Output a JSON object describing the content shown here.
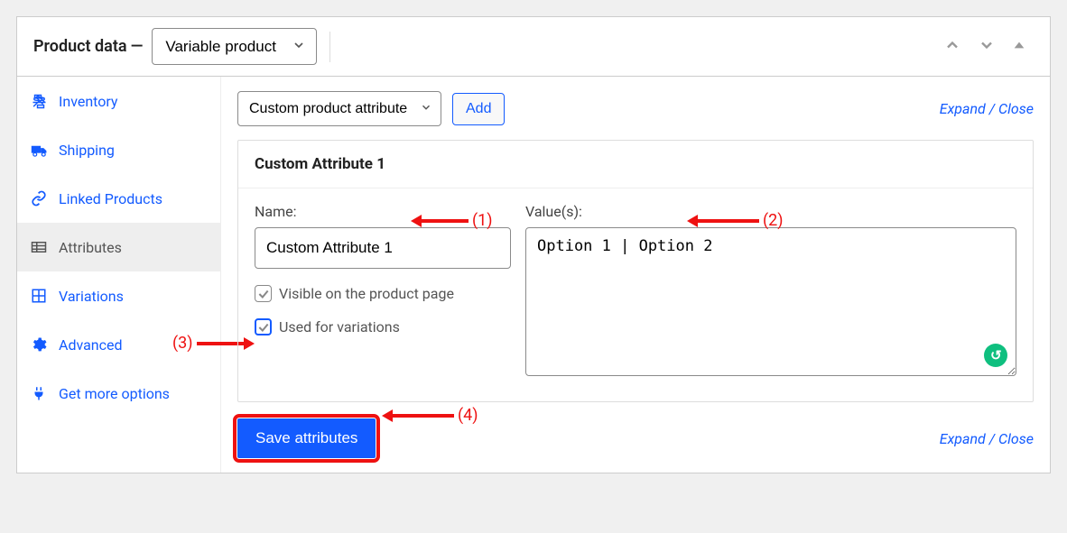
{
  "header": {
    "title": "Product data",
    "product_type": "Variable product"
  },
  "sidebar": {
    "items": [
      {
        "label": "Inventory"
      },
      {
        "label": "Shipping"
      },
      {
        "label": "Linked Products"
      },
      {
        "label": "Attributes"
      },
      {
        "label": "Variations"
      },
      {
        "label": "Advanced"
      },
      {
        "label": "Get more options"
      }
    ]
  },
  "main": {
    "attr_select": "Custom product attribute",
    "add_label": "Add",
    "expand": "Expand",
    "close": "Close",
    "panel_title": "Custom Attribute 1",
    "name_label": "Name:",
    "name_value": "Custom Attribute 1",
    "values_label": "Value(s):",
    "values_value": "Option 1 | Option 2",
    "visible_label": "Visible on the product page",
    "usedvar_label": "Used for variations",
    "save_label": "Save attributes"
  },
  "annotations": {
    "a1": "(1)",
    "a2": "(2)",
    "a3": "(3)",
    "a4": "(4)"
  }
}
